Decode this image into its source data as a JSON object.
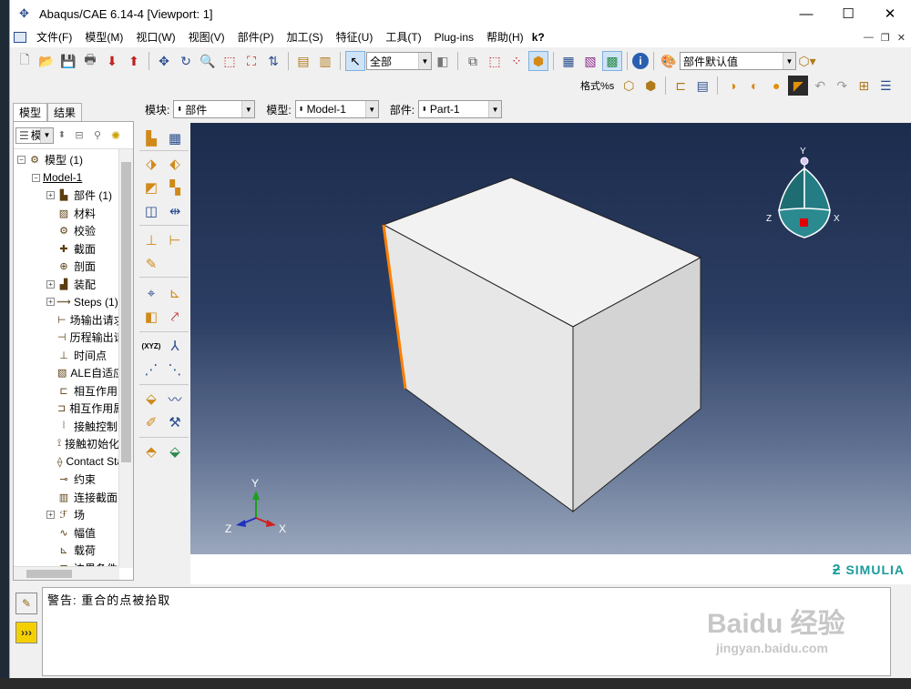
{
  "window": {
    "title": "Abaqus/CAE 6.14-4 [Viewport: 1]",
    "minimize": "—",
    "maximize": "☐",
    "close": "✕"
  },
  "menu": [
    "文件(F)",
    "模型(M)",
    "视口(W)",
    "视图(V)",
    "部件(P)",
    "加工(S)",
    "特征(U)",
    "工具(T)",
    "Plug-ins",
    "帮助(H)",
    "k?"
  ],
  "toolbar": {
    "select_scope": "全部",
    "display_group": "部件默认值",
    "render_label": "格式%s"
  },
  "context": {
    "module_label": "模块:",
    "module_value": "部件",
    "model_label": "模型:",
    "model_value": "Model-1",
    "part_label": "部件:",
    "part_value": "Part-1"
  },
  "tabs": [
    "模型",
    "结果"
  ],
  "treetools": {
    "combo": "模"
  },
  "tree": [
    {
      "label": "模型 (1)",
      "exp": "⊟",
      "indent": 0,
      "icon": "model-icon"
    },
    {
      "label": "Model-1",
      "exp": "⊟",
      "indent": 1,
      "icon": "",
      "underline": true
    },
    {
      "label": "部件 (1)",
      "exp": "⊞",
      "indent": 2,
      "icon": "part-icon"
    },
    {
      "label": "材料",
      "exp": "",
      "indent": 2,
      "icon": "material-icon"
    },
    {
      "label": "校验",
      "exp": "",
      "indent": 2,
      "icon": "calibration-icon"
    },
    {
      "label": "截面",
      "exp": "",
      "indent": 2,
      "icon": "section-icon"
    },
    {
      "label": "剖面",
      "exp": "",
      "indent": 2,
      "icon": "profile-icon"
    },
    {
      "label": "装配",
      "exp": "⊞",
      "indent": 2,
      "icon": "assembly-icon"
    },
    {
      "label": "Steps (1)",
      "exp": "⊞",
      "indent": 2,
      "icon": "steps-icon"
    },
    {
      "label": "场输出请求",
      "exp": "",
      "indent": 2,
      "icon": "field-output-icon"
    },
    {
      "label": "历程输出请求",
      "exp": "",
      "indent": 2,
      "icon": "history-output-icon"
    },
    {
      "label": "时间点",
      "exp": "",
      "indent": 2,
      "icon": "time-points-icon"
    },
    {
      "label": "ALE自适应",
      "exp": "",
      "indent": 2,
      "icon": "ale-icon"
    },
    {
      "label": "相互作用",
      "exp": "",
      "indent": 2,
      "icon": "interaction-icon"
    },
    {
      "label": "相互作用属性",
      "exp": "",
      "indent": 2,
      "icon": "interaction-property-icon"
    },
    {
      "label": "接触控制",
      "exp": "",
      "indent": 2,
      "icon": "contact-control-icon"
    },
    {
      "label": "接触初始化",
      "exp": "",
      "indent": 2,
      "icon": "contact-init-icon"
    },
    {
      "label": "Contact Stabilization",
      "exp": "",
      "indent": 2,
      "icon": "contact-stab-icon"
    },
    {
      "label": "约束",
      "exp": "",
      "indent": 2,
      "icon": "constraint-icon"
    },
    {
      "label": "连接截面",
      "exp": "",
      "indent": 2,
      "icon": "connector-section-icon"
    },
    {
      "label": "场",
      "exp": "⊞",
      "indent": 2,
      "icon": "field-icon"
    },
    {
      "label": "幅值",
      "exp": "",
      "indent": 2,
      "icon": "amplitude-icon"
    },
    {
      "label": "载荷",
      "exp": "",
      "indent": 2,
      "icon": "load-icon"
    },
    {
      "label": "边界条件",
      "exp": "",
      "indent": 2,
      "icon": "bc-icon"
    }
  ],
  "triad": {
    "y": "Y",
    "z": "Z",
    "x": "X"
  },
  "view_cube": {
    "y": "Y",
    "z": "Z",
    "x": "X"
  },
  "brand": "SIMULIA",
  "message": "警告: 重合的点被拾取",
  "watermark": {
    "main": "Baidu 经验",
    "url": "jingyan.baidu.com"
  },
  "colors": {
    "viewport_top": "#1c2c4d",
    "viewport_bottom": "#9aa7bd",
    "part_face_front": "#e7e7e7",
    "part_face_top": "#f2f2f2",
    "part_face_side": "#d4d4d4",
    "edge_highlight": "#ff7f00",
    "brand": "#1a9b9b"
  }
}
